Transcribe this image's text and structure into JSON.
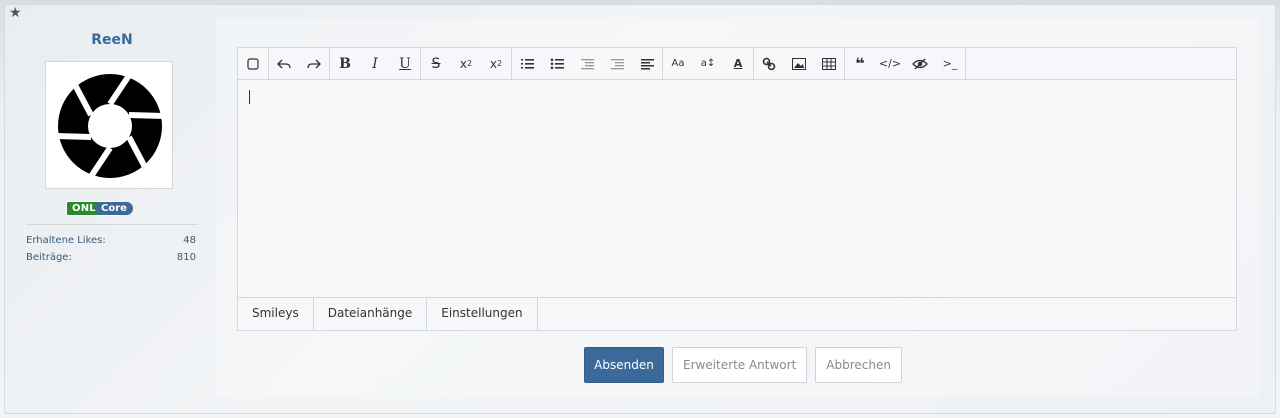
{
  "sidebar": {
    "username": "ReeN",
    "online_label": "ONLINE",
    "rank": "Core",
    "stats": [
      {
        "label": "Erhaltene Likes:",
        "value": "48"
      },
      {
        "label": "Beiträge:",
        "value": "810"
      }
    ]
  },
  "toolbar": {
    "buttons": [
      "source-toggle-icon",
      "undo-icon",
      "redo-icon",
      "bold-icon",
      "italic-icon",
      "underline-icon",
      "strikethrough-icon",
      "subscript-icon",
      "superscript-icon",
      "ordered-list-icon",
      "unordered-list-icon",
      "outdent-icon",
      "indent-icon",
      "align-icon",
      "font-family-icon",
      "font-size-icon",
      "font-color-icon",
      "link-icon",
      "image-icon",
      "table-icon",
      "quote-icon",
      "code-icon",
      "spoiler-icon",
      "terminal-icon"
    ]
  },
  "tabs": [
    "Smileys",
    "Dateianhänge",
    "Einstellungen"
  ],
  "actions": {
    "submit": "Absenden",
    "extended_reply": "Erweiterte Antwort",
    "cancel": "Abbrechen"
  },
  "colors": {
    "accent": "#3b6a9a",
    "online": "#2b8a2b"
  }
}
